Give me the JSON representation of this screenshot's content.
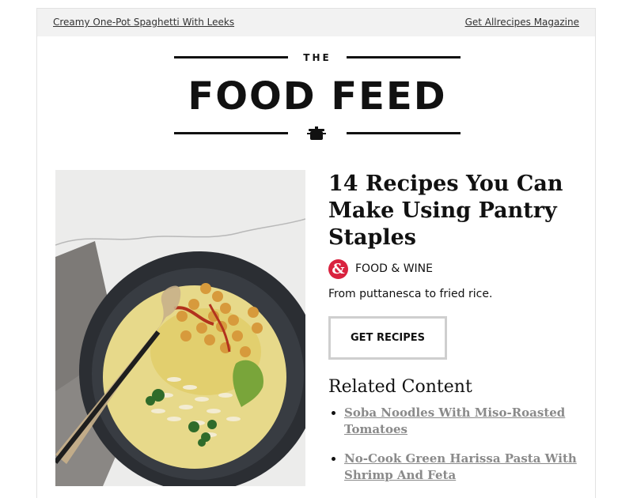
{
  "topbar": {
    "left_link": "Creamy One-Pot Spaghetti With Leeks",
    "right_link": "Get Allrecipes Magazine"
  },
  "masthead": {
    "the": "THE",
    "title": "FOOD FEED",
    "icon": "cooking-pot-icon"
  },
  "feature": {
    "image": "bowl-of-soup-with-chickpeas-and-orzo",
    "headline": "14 Recipes You Can Make Using Pantry Staples",
    "source_logo": "&",
    "source_name": "FOOD & WINE",
    "summary": "From puttanesca to fried rice.",
    "cta_label": "GET RECIPES"
  },
  "related": {
    "title": "Related Content",
    "items": [
      {
        "label": "Soba Noodles With Miso-Roasted Tomatoes"
      },
      {
        "label": "No-Cook Green Harissa Pasta With Shrimp And Feta"
      }
    ]
  },
  "colors": {
    "accent": "#d9223f",
    "link_gray": "#8a8a8a",
    "topbar_bg": "#f2f2f2"
  }
}
